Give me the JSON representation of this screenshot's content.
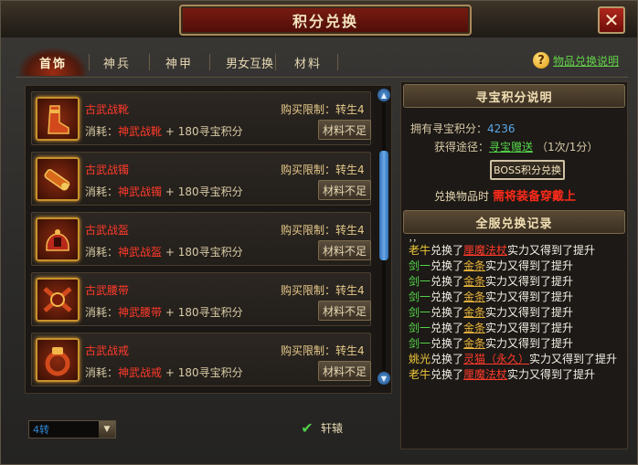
{
  "window": {
    "title": "积分兑换",
    "close_symbol": "✕"
  },
  "tabs": [
    {
      "label": "首饰",
      "active": true
    },
    {
      "label": "神兵",
      "active": false
    },
    {
      "label": "神甲",
      "active": false
    },
    {
      "label": "男女互换",
      "active": false
    },
    {
      "label": "材料",
      "active": false
    }
  ],
  "help": {
    "icon": "?",
    "label": "物品兑换说明"
  },
  "items": [
    {
      "name": "古武战靴",
      "limit": "购买限制：转生4",
      "cost_prefix": "消耗：",
      "cost_item": "神武战靴",
      "cost_suffix": " + 180寻宝积分",
      "button": "材料不足",
      "icon": "boots-icon"
    },
    {
      "name": "古武战镯",
      "limit": "购买限制：转生4",
      "cost_prefix": "消耗：",
      "cost_item": "神武战镯",
      "cost_suffix": " + 180寻宝积分",
      "button": "材料不足",
      "icon": "bracelet-icon"
    },
    {
      "name": "古武战盔",
      "limit": "购买限制：转生4",
      "cost_prefix": "消耗：",
      "cost_item": "神武战盔",
      "cost_suffix": " + 180寻宝积分",
      "button": "材料不足",
      "icon": "helmet-icon"
    },
    {
      "name": "古武腰带",
      "limit": "购买限制：转生4",
      "cost_prefix": "消耗：",
      "cost_item": "神武腰带",
      "cost_suffix": " + 180寻宝积分",
      "button": "材料不足",
      "icon": "belt-icon"
    },
    {
      "name": "古武战戒",
      "limit": "购买限制：转生4",
      "cost_prefix": "消耗：",
      "cost_item": "神武战戒",
      "cost_suffix": " + 180寻宝积分",
      "button": "材料不足",
      "icon": "ring-icon"
    }
  ],
  "filter": {
    "value": "4转",
    "arrow": "▼"
  },
  "checkbox": {
    "checked": true,
    "mark": "✔",
    "label": "轩辕"
  },
  "points_info": {
    "header": "寻宝积分说明",
    "owned_label": "拥有寻宝积分：",
    "owned_value": "4236",
    "source_label": "获得途径：",
    "source_link": "寻宝赠送",
    "source_rate": "（1次/1分）",
    "boss_button": "BOSS积分兑换",
    "exchange_label": "兑换物品时",
    "exchange_warning": "需将装备穿戴上"
  },
  "server_log": {
    "header": "全服兑换记录",
    "top_fragment": "，，",
    "entries": [
      {
        "player": "老牛",
        "player_color": "yellow",
        "action": "兑换了",
        "item": "厘魔法杖",
        "item_color": "red",
        "result": "实力又得到了提升"
      },
      {
        "player": "剑一",
        "player_color": "green",
        "action": "兑换了",
        "item": "金条",
        "item_color": "gold",
        "result": "实力又得到了提升"
      },
      {
        "player": "剑一",
        "player_color": "green",
        "action": "兑换了",
        "item": "金条",
        "item_color": "gold",
        "result": "实力又得到了提升"
      },
      {
        "player": "剑一",
        "player_color": "green",
        "action": "兑换了",
        "item": "金条",
        "item_color": "gold",
        "result": "实力又得到了提升"
      },
      {
        "player": "剑一",
        "player_color": "green",
        "action": "兑换了",
        "item": "金条",
        "item_color": "gold",
        "result": "实力又得到了提升"
      },
      {
        "player": "剑一",
        "player_color": "green",
        "action": "兑换了",
        "item": "金条",
        "item_color": "gold",
        "result": "实力又得到了提升"
      },
      {
        "player": "剑一",
        "player_color": "green",
        "action": "兑换了",
        "item": "金条",
        "item_color": "gold",
        "result": "实力又得到了提升"
      },
      {
        "player": "姚光",
        "player_color": "yellow",
        "action": "兑换了",
        "item": "灵猫（永久）",
        "item_color": "red",
        "result": "实力又得到了提升"
      },
      {
        "player": "老牛",
        "player_color": "yellow",
        "action": "兑换了",
        "item": "厘魔法杖",
        "item_color": "red",
        "result": "实力又得到了提升"
      }
    ]
  },
  "colors": {
    "accent_red": "#ff3a2a",
    "link_green": "#56d64a",
    "points_blue": "#5aa8e8",
    "warning_red": "#ff2a1a"
  }
}
